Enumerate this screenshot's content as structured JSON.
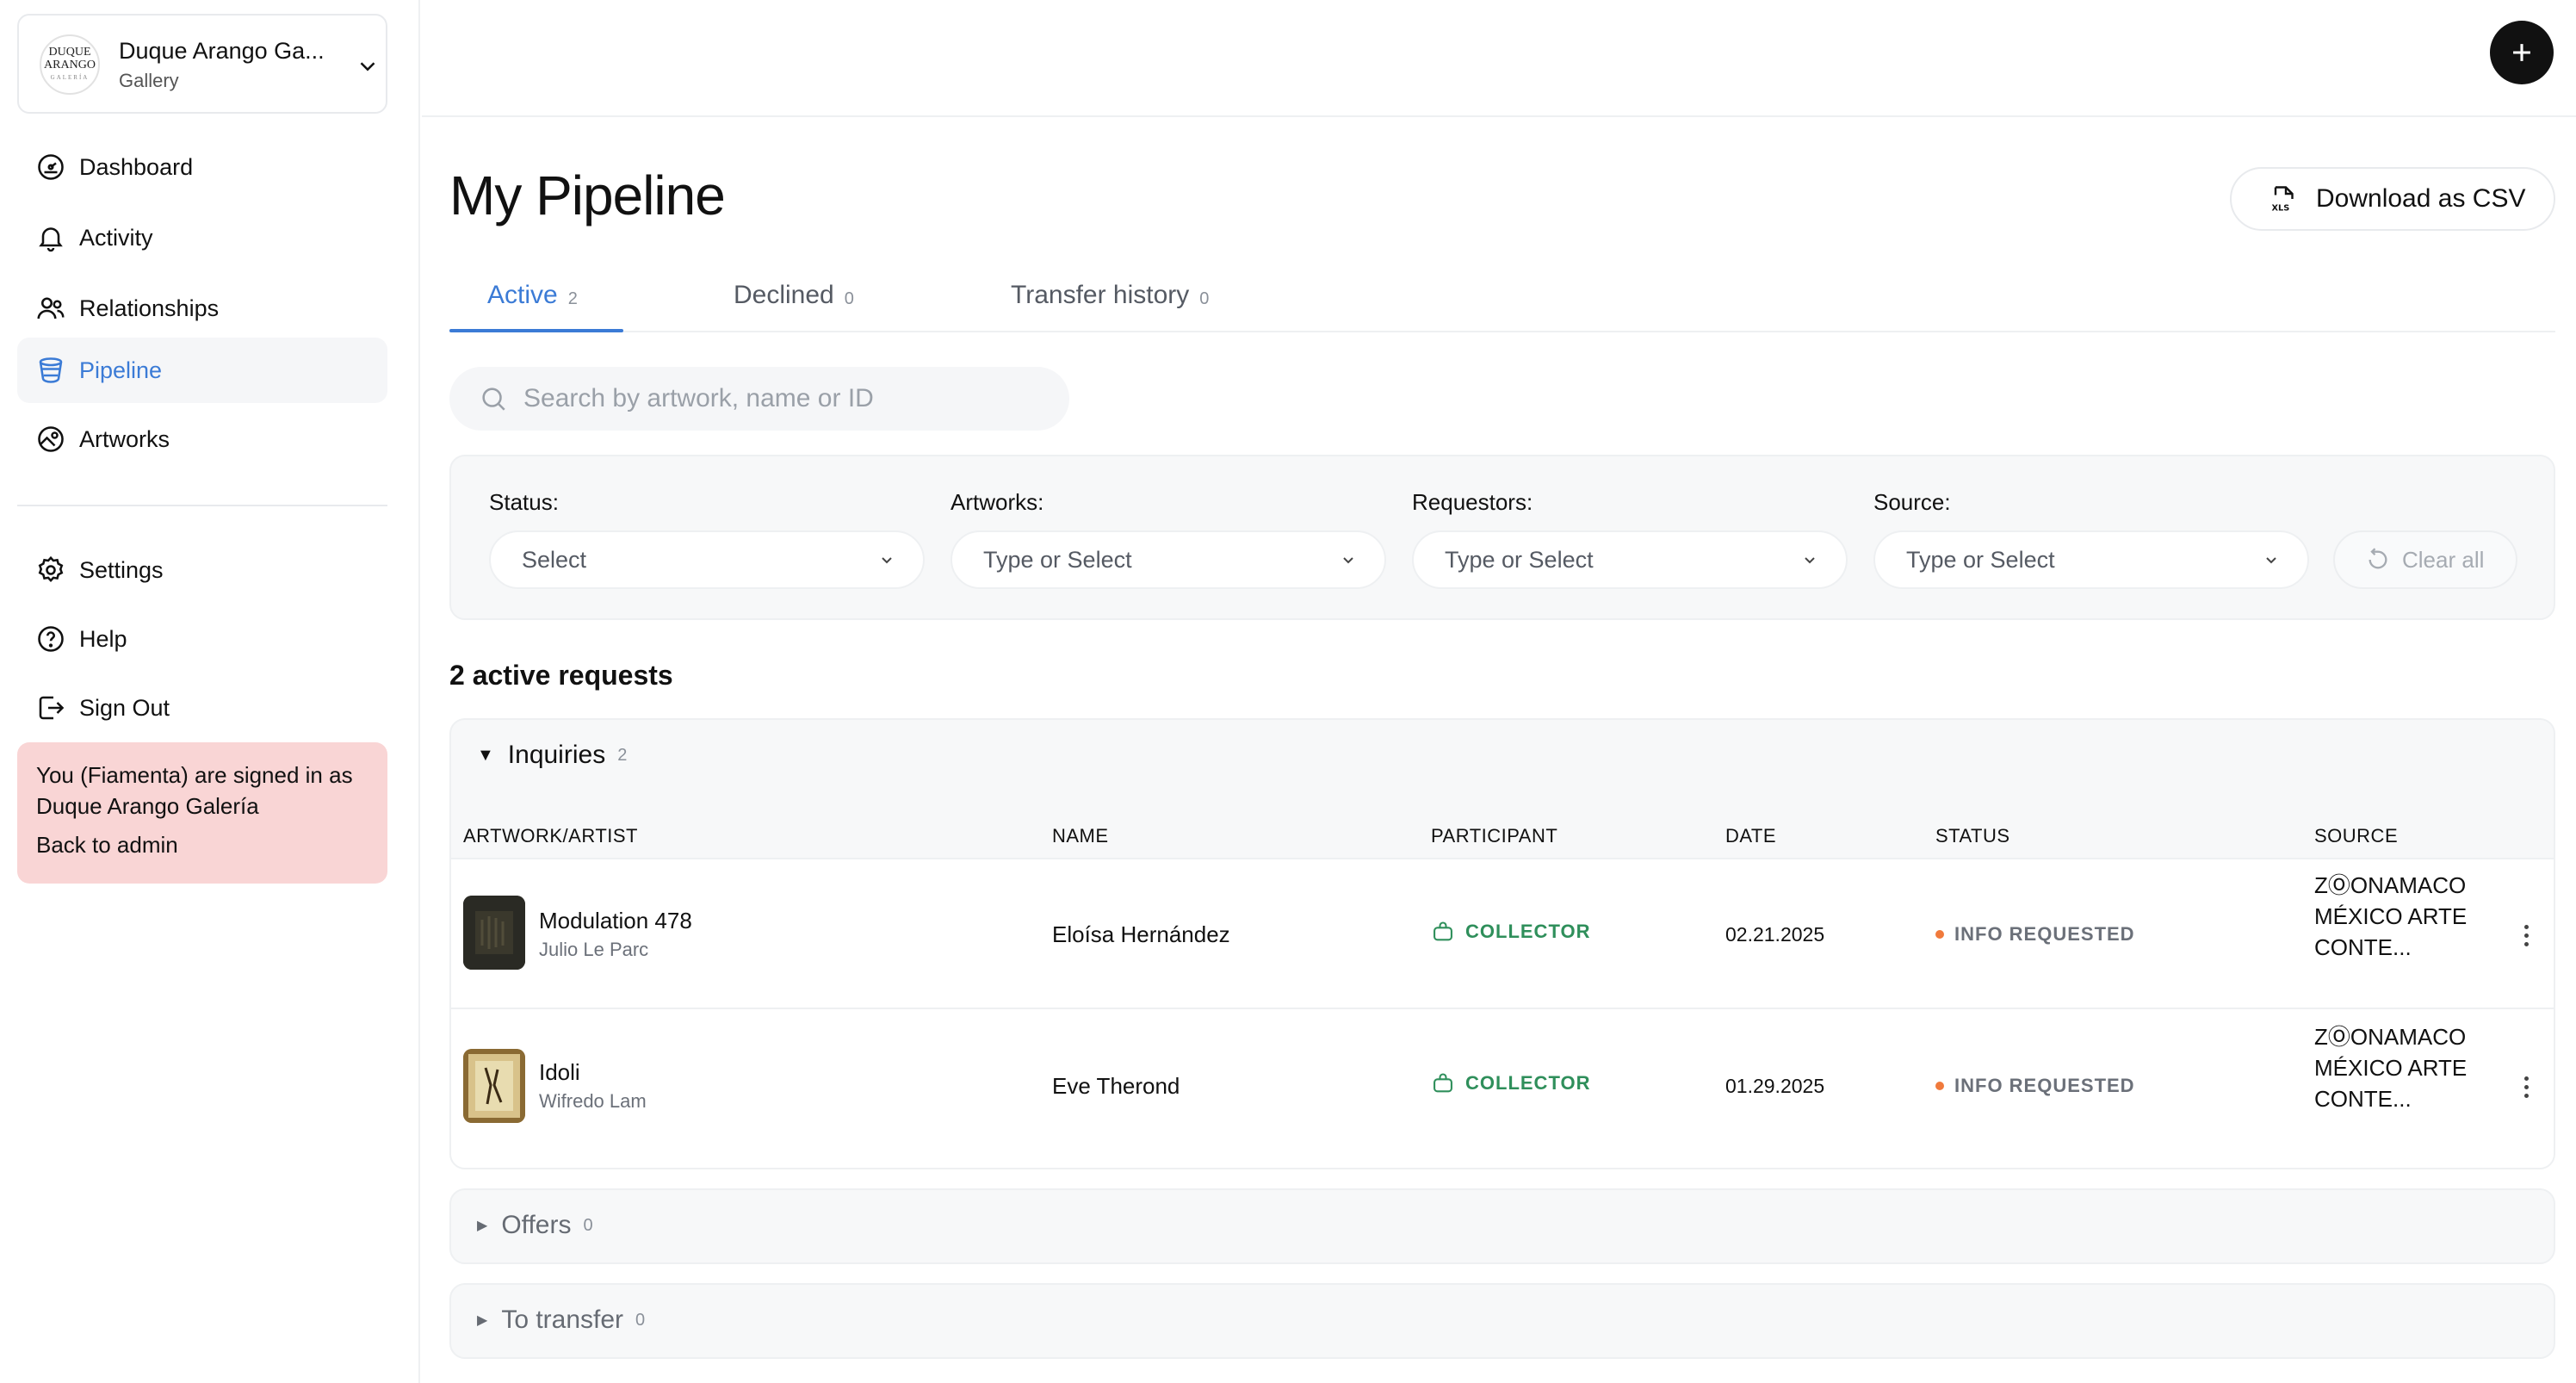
{
  "org": {
    "name": "Duque Arango Ga...",
    "type": "Gallery",
    "logo_line1": "DUQUE",
    "logo_line2": "ARANGO",
    "logo_line3": "GALERÍA"
  },
  "nav": {
    "items": [
      {
        "label": "Dashboard",
        "icon": "dashboard-icon"
      },
      {
        "label": "Activity",
        "icon": "bell-icon"
      },
      {
        "label": "Relationships",
        "icon": "users-icon"
      },
      {
        "label": "Pipeline",
        "icon": "pipeline-icon",
        "active": true
      },
      {
        "label": "Artworks",
        "icon": "artwork-icon"
      }
    ],
    "secondary": [
      {
        "label": "Settings",
        "icon": "gear-icon"
      },
      {
        "label": "Help",
        "icon": "help-icon"
      },
      {
        "label": "Sign Out",
        "icon": "sign-out-icon"
      }
    ]
  },
  "admin": {
    "message": "You (Fiamenta) are signed in as Duque Arango Galería",
    "back": "Back to admin"
  },
  "page": {
    "title": "My Pipeline",
    "csv_label": "Download as CSV",
    "csv_icon_text": "XLS"
  },
  "tabs": [
    {
      "label": "Active",
      "count": "2"
    },
    {
      "label": "Declined",
      "count": "0"
    },
    {
      "label": "Transfer history",
      "count": "0"
    }
  ],
  "search": {
    "placeholder": "Search by artwork, name or ID"
  },
  "filters": {
    "status": {
      "label": "Status:",
      "placeholder": "Select"
    },
    "artworks": {
      "label": "Artworks:",
      "placeholder": "Type or Select"
    },
    "requestors": {
      "label": "Requestors:",
      "placeholder": "Type or Select"
    },
    "source": {
      "label": "Source:",
      "placeholder": "Type or Select"
    },
    "clear_label": "Clear all"
  },
  "summary": "2 active requests",
  "groups": {
    "inquiries": {
      "label": "Inquiries",
      "count": "2"
    },
    "offers": {
      "label": "Offers",
      "count": "0"
    },
    "to_transfer": {
      "label": "To transfer",
      "count": "0"
    }
  },
  "table": {
    "headers": {
      "artwork": "ARTWORK/ARTIST",
      "name": "NAME",
      "participant": "PARTICIPANT",
      "date": "DATE",
      "status": "STATUS",
      "source": "SOURCE"
    },
    "rows": [
      {
        "title": "Modulation 478",
        "artist": "Julio Le Parc",
        "name": "Eloísa Hernández",
        "participant": "COLLECTOR",
        "date": "02.21.2025",
        "status": "INFO REQUESTED",
        "source": "ZⓄONAMACO MÉXICO ARTE CONTE..."
      },
      {
        "title": "Idoli",
        "artist": "Wifredo Lam",
        "name": "Eve Therond",
        "participant": "COLLECTOR",
        "date": "01.29.2025",
        "status": "INFO REQUESTED",
        "source": "ZⓄONAMACO MÉXICO ARTE CONTE..."
      }
    ]
  },
  "colors": {
    "accent": "#3b7bd6",
    "collector": "#2f8f5b",
    "status_dot": "#f07a3c",
    "admin_bg": "#f9d5d5"
  }
}
